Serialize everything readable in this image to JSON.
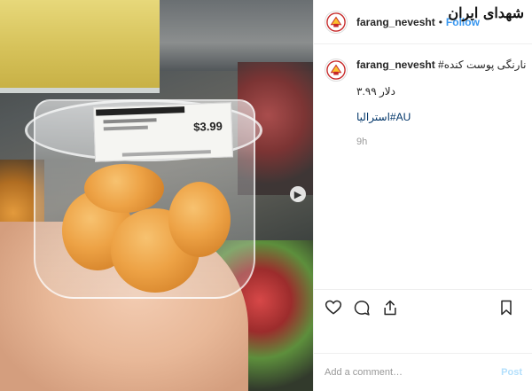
{
  "header": {
    "username": "farang_nevesht",
    "separator": "•",
    "follow_label": "Follow",
    "watermark": "شهدای ایران"
  },
  "post": {
    "username": "farang_nevesht",
    "caption": "نارنگی پوست کنده#",
    "price_line": "دلار ۳.۹۹",
    "tag_line": "استرالیا#AU",
    "time": "9h"
  },
  "photo": {
    "price_tag": "$3.99"
  },
  "actions": {
    "like_icon": "heart-icon",
    "comment_icon": "comment-icon",
    "share_icon": "share-icon",
    "save_icon": "bookmark-icon"
  },
  "comment_box": {
    "placeholder": "Add a comment…",
    "post_label": "Post"
  },
  "colors": {
    "link": "#3897f0",
    "muted": "#999999",
    "border": "#efefef"
  }
}
